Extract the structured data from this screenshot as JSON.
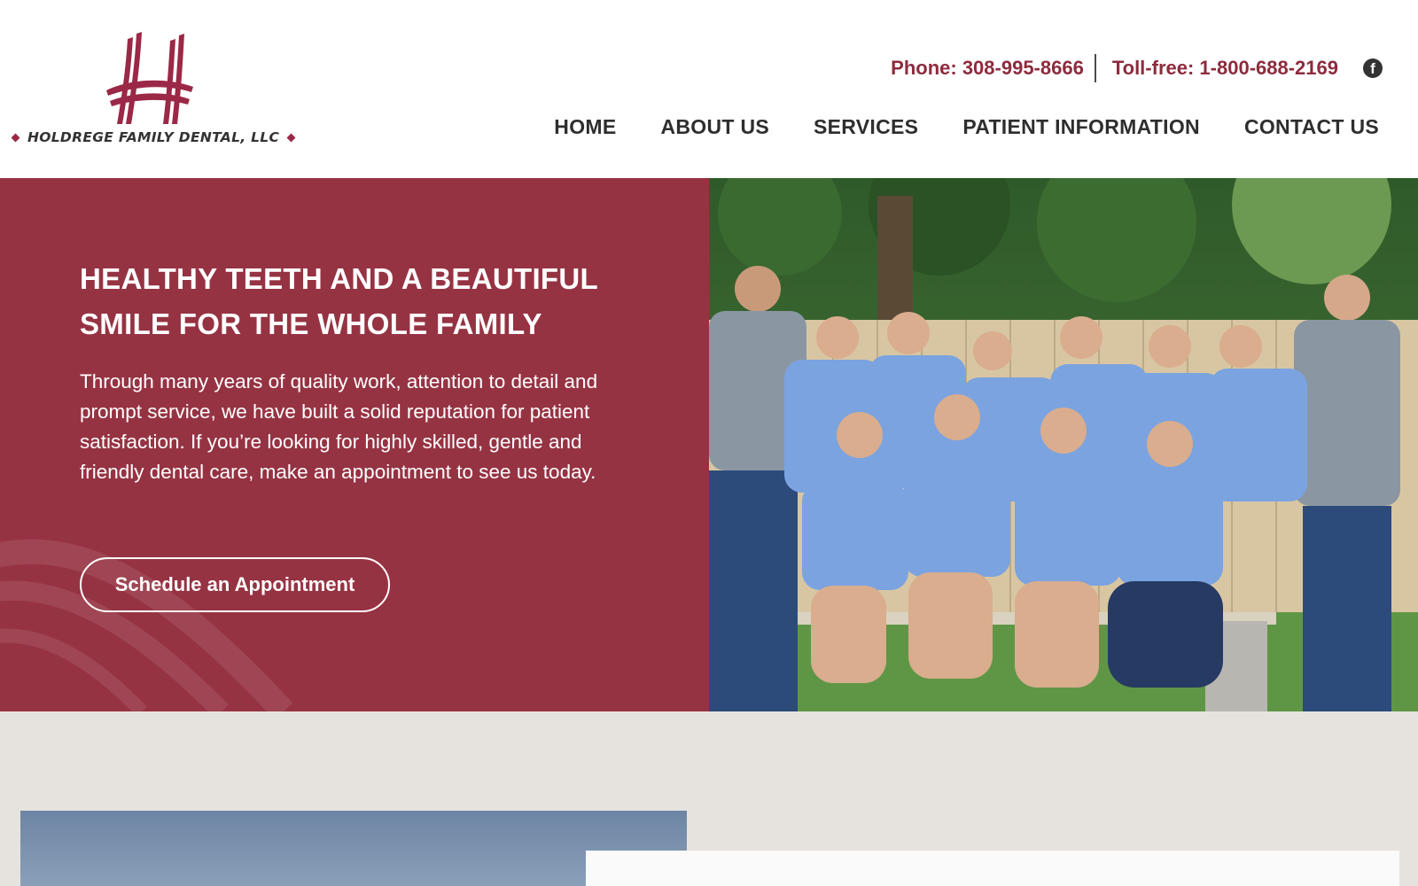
{
  "header": {
    "logo_name": "HOLDREGE FAMILY DENTAL, LLC",
    "phone_label": "Phone: 308-995-8666",
    "tollfree_label": "Toll-free: 1-800-688-2169",
    "social_icon": "facebook-icon",
    "nav": [
      {
        "label": "HOME"
      },
      {
        "label": "ABOUT US"
      },
      {
        "label": "SERVICES"
      },
      {
        "label": "PATIENT INFORMATION"
      },
      {
        "label": "CONTACT US"
      }
    ]
  },
  "hero": {
    "heading": "HEALTHY TEETH AND A BEAUTIFUL SMILE FOR THE WHOLE FAMILY",
    "body": "Through many years of quality work, attention to detail and prompt service, we have built a solid reputation for patient satisfaction. If you’re looking for highly skilled, gentle and friendly dental care, make an appointment to see us today.",
    "cta_label": "Schedule an Appointment"
  },
  "colors": {
    "brand": "#963343",
    "brand_text": "#8d2b3d",
    "nav_text": "#2e2e2e",
    "section_bg": "#e6e3de"
  }
}
